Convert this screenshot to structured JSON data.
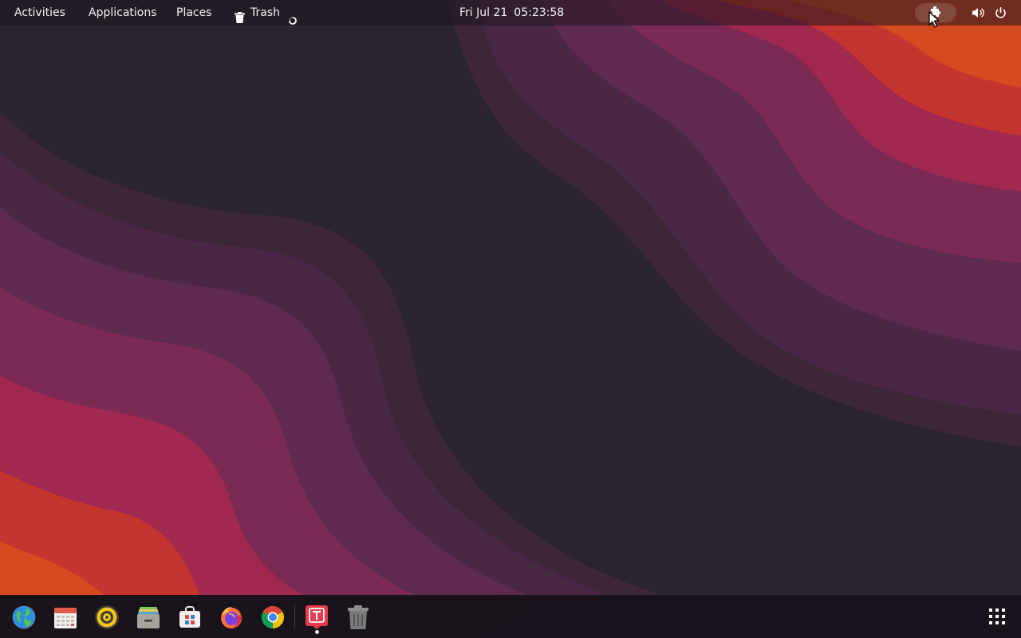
{
  "topbar": {
    "activities": "Activities",
    "applications": "Applications",
    "places": "Places",
    "trash_label": "Trash",
    "clock_date": "Fri Jul 21",
    "clock_time": "05:23:58",
    "icons": [
      "trash-icon",
      "loading-spinner-icon",
      "extension-puzzle-icon",
      "volume-icon",
      "power-icon"
    ]
  },
  "dock": {
    "items": [
      {
        "name": "globe-browser-icon"
      },
      {
        "name": "calendar-icon"
      },
      {
        "name": "rhythmbox-music-icon"
      },
      {
        "name": "file-archive-icon"
      },
      {
        "name": "software-store-icon"
      },
      {
        "name": "firefox-icon"
      },
      {
        "name": "chrome-icon"
      },
      {
        "name": "typora-text-icon",
        "running": true
      },
      {
        "name": "trash-bin-icon"
      }
    ],
    "show_apps": "show-applications-grid-icon"
  },
  "colors": {
    "wallpaper_dark": "#2b2230",
    "wallpaper_purple": "#5a2a52",
    "wallpaper_magenta": "#9e2450",
    "wallpaper_red": "#c53a2b",
    "wallpaper_orange": "#d9551f"
  }
}
